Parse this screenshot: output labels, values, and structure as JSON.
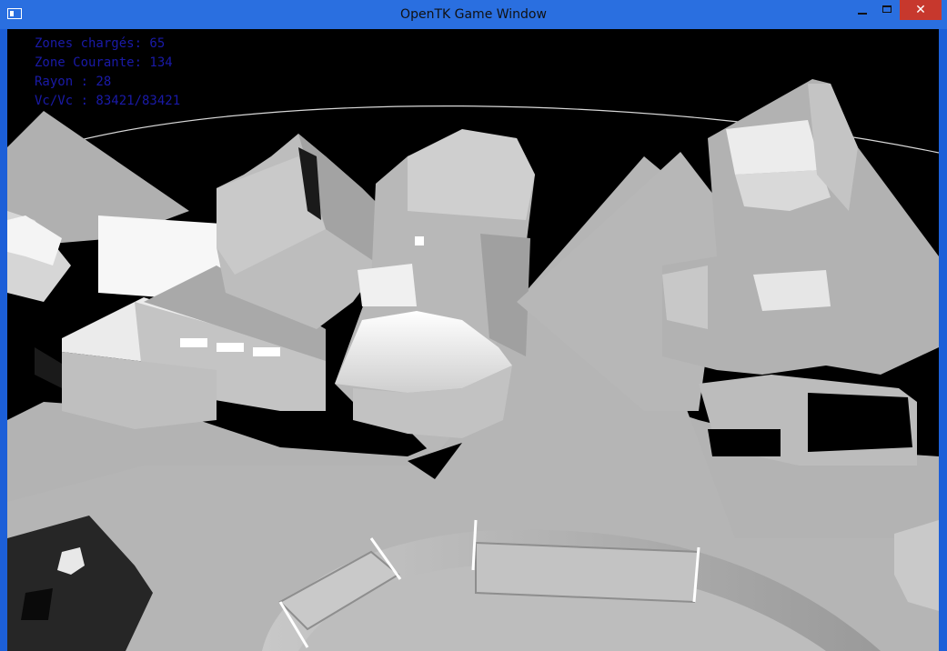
{
  "window": {
    "title": "OpenTK Game Window",
    "close_glyph": "✕",
    "minimize_icon": "minimize-icon",
    "maximize_icon": "maximize-icon",
    "close_icon": "close-icon",
    "app_icon": "window-icon"
  },
  "hud": {
    "zones_loaded": "Zones chargés: 65",
    "current_zone": "Zone Courante: 134",
    "radius": "Rayon : 28",
    "vertex_counts": "Vc/Vc : 83421/83421"
  },
  "colors": {
    "titlebar": "#2a6fe0",
    "close_button": "#c7382d",
    "hud_text": "#1a1aa8",
    "scene_background": "#000000"
  }
}
